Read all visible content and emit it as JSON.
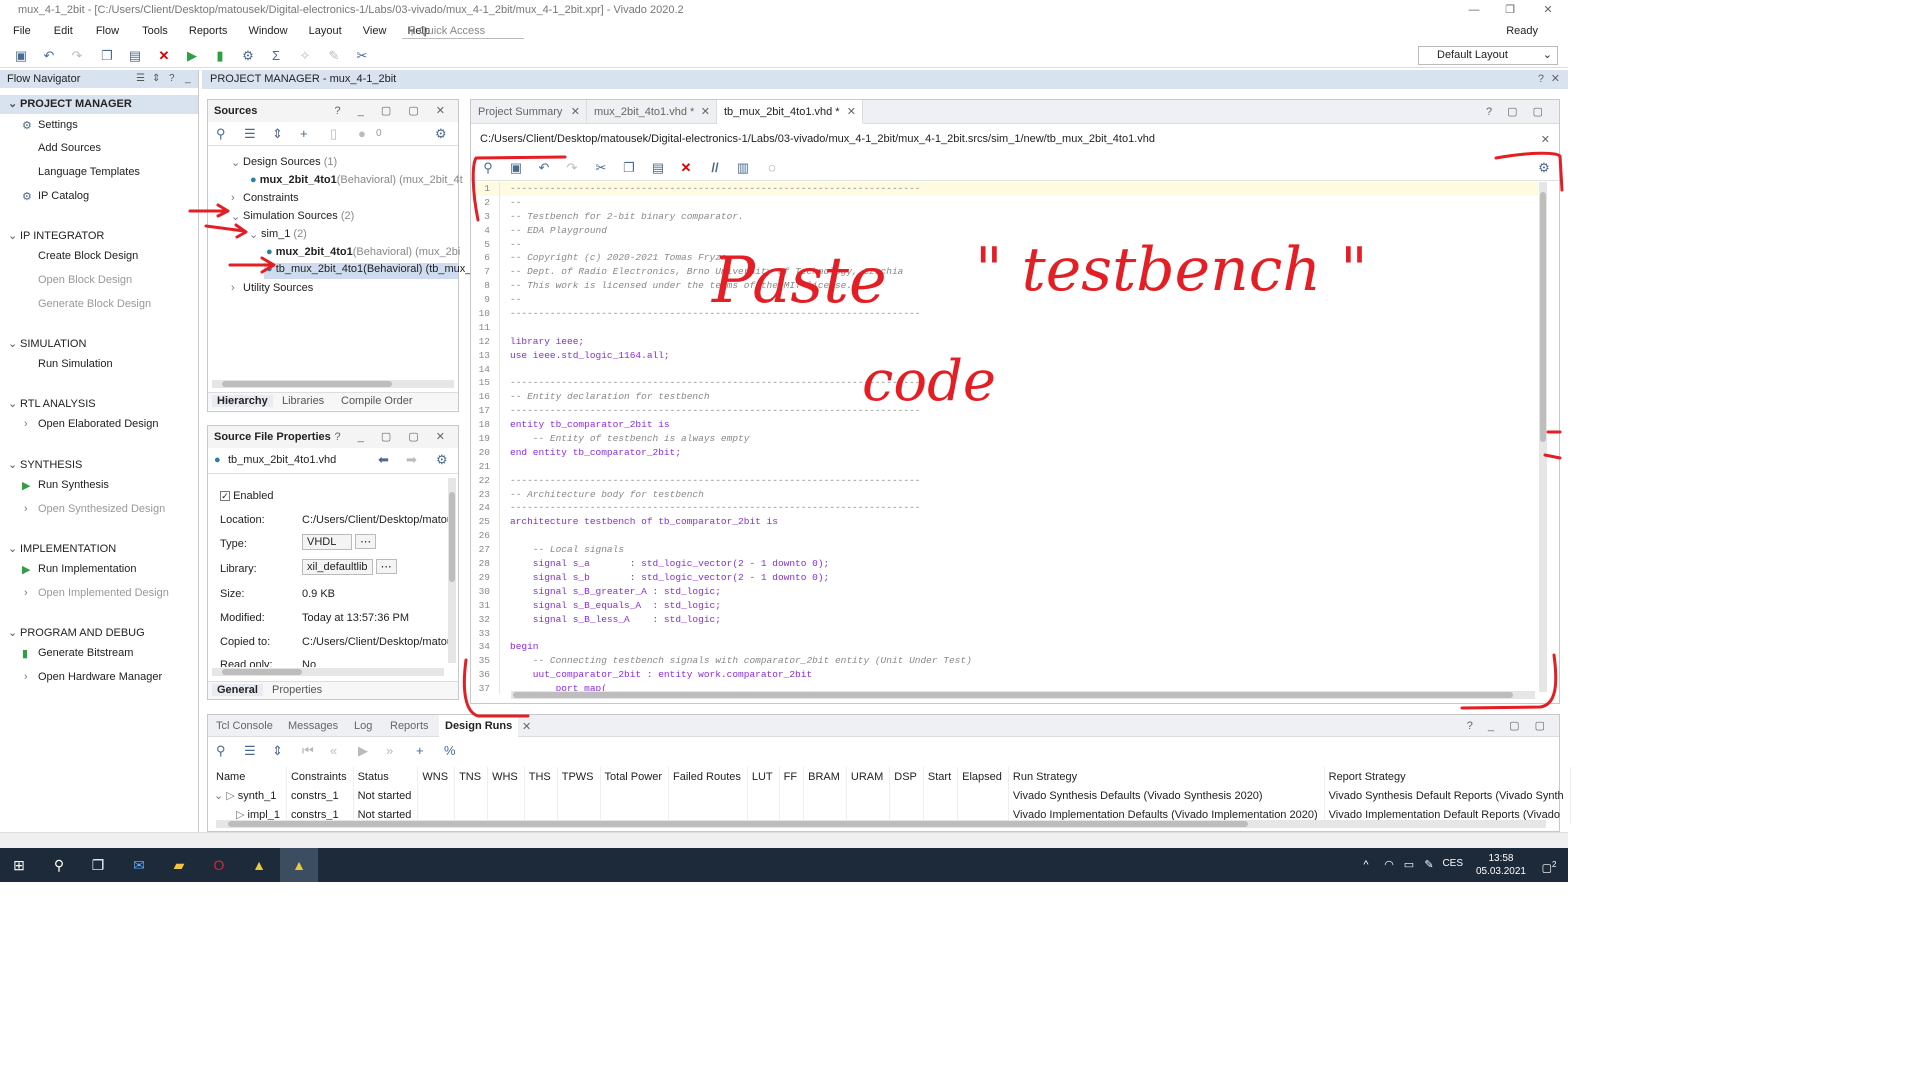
{
  "window": {
    "title": "mux_4-1_2bit - [C:/Users/Client/Desktop/matousek/Digital-electronics-1/Labs/03-vivado/mux_4-1_2bit/mux_4-1_2bit.xpr] - Vivado 2020.2"
  },
  "menu": {
    "items": [
      "File",
      "Edit",
      "Flow",
      "Tools",
      "Reports",
      "Window",
      "Layout",
      "View",
      "Help"
    ],
    "quick_access": "Quick Access",
    "status": "Ready",
    "layout": "Default Layout"
  },
  "flow_nav": {
    "title": "Flow Navigator",
    "sections": [
      {
        "label": "PROJECT MANAGER",
        "items": [
          {
            "label": "Settings"
          },
          {
            "label": "Add Sources"
          },
          {
            "label": "Language Templates"
          },
          {
            "label": "IP Catalog"
          }
        ]
      },
      {
        "label": "IP INTEGRATOR",
        "items": [
          {
            "label": "Create Block Design"
          },
          {
            "label": "Open Block Design"
          },
          {
            "label": "Generate Block Design"
          }
        ]
      },
      {
        "label": "SIMULATION",
        "items": [
          {
            "label": "Run Simulation"
          }
        ]
      },
      {
        "label": "RTL ANALYSIS",
        "items": [
          {
            "label": "Open Elaborated Design"
          }
        ]
      },
      {
        "label": "SYNTHESIS",
        "items": [
          {
            "label": "Run Synthesis"
          },
          {
            "label": "Open Synthesized Design"
          }
        ]
      },
      {
        "label": "IMPLEMENTATION",
        "items": [
          {
            "label": "Run Implementation"
          },
          {
            "label": "Open Implemented Design"
          }
        ]
      },
      {
        "label": "PROGRAM AND DEBUG",
        "items": [
          {
            "label": "Generate Bitstream"
          },
          {
            "label": "Open Hardware Manager"
          }
        ]
      }
    ]
  },
  "pm_bar": {
    "label": "PROJECT MANAGER - mux_4-1_2bit"
  },
  "sources": {
    "title": "Sources",
    "count": "0",
    "tree": [
      {
        "label": "Design Sources",
        "count": "(1)"
      },
      {
        "name": "mux_2bit_4to1",
        "detail": "(Behavioral) (mux_2bit_4t"
      },
      {
        "label": "Constraints"
      },
      {
        "label": "Simulation Sources",
        "count": "(2)"
      },
      {
        "label": "sim_1",
        "count": "(2)"
      },
      {
        "name": "mux_2bit_4to1",
        "detail": "(Behavioral) (mux_2bi"
      },
      {
        "name": "tb_mux_2bit_4to1(Behavioral) (tb_mux_"
      },
      {
        "label": "Utility Sources"
      }
    ],
    "tabs": [
      "Hierarchy",
      "Libraries",
      "Compile Order"
    ]
  },
  "props": {
    "title": "Source File Properties",
    "file": "tb_mux_2bit_4to1.vhd",
    "enabled": "Enabled",
    "rows": [
      {
        "k": "Location:",
        "v": "C:/Users/Client/Desktop/matous"
      },
      {
        "k": "Type:",
        "v": "VHDL"
      },
      {
        "k": "Library:",
        "v": "xil_defaultlib"
      },
      {
        "k": "Size:",
        "v": "0.9 KB"
      },
      {
        "k": "Modified:",
        "v": "Today at 13:57:36 PM"
      },
      {
        "k": "Copied to:",
        "v": "C:/Users/Client/Desktop/matous"
      },
      {
        "k": "Read only:",
        "v": "No"
      }
    ],
    "tabs": [
      "General",
      "Properties"
    ]
  },
  "editor": {
    "tabs": [
      {
        "label": "Project Summary"
      },
      {
        "label": "mux_2bit_4to1.vhd *"
      },
      {
        "label": "tb_mux_2bit_4to1.vhd *"
      }
    ],
    "path": "C:/Users/Client/Desktop/matousek/Digital-electronics-1/Labs/03-vivado/mux_4-1_2bit/mux_4-1_2bit.srcs/sim_1/new/tb_mux_2bit_4to1.vhd",
    "lines": [
      {
        "n": "1",
        "t": "------------------------------------------------------------------------",
        "k": "com"
      },
      {
        "n": "2",
        "t": "--",
        "k": "com"
      },
      {
        "n": "3",
        "t": "-- Testbench for 2-bit binary comparator.",
        "k": "com"
      },
      {
        "n": "4",
        "t": "-- EDA Playground",
        "k": "com"
      },
      {
        "n": "5",
        "t": "--",
        "k": "com"
      },
      {
        "n": "6",
        "t": "-- Copyright (c) 2020-2021 Tomas Fryza",
        "k": "com"
      },
      {
        "n": "7",
        "t": "-- Dept. of Radio Electronics, Brno University of Technology, Czechia",
        "k": "com"
      },
      {
        "n": "8",
        "t": "-- This work is licensed under the terms of the MIT license.",
        "k": "com"
      },
      {
        "n": "9",
        "t": "--",
        "k": "com"
      },
      {
        "n": "10",
        "t": "------------------------------------------------------------------------",
        "k": "com"
      },
      {
        "n": "11",
        "t": "",
        "k": ""
      },
      {
        "n": "12",
        "t": "library ieee;",
        "k": "kw"
      },
      {
        "n": "13",
        "t": "use ieee.std_logic_1164.all;",
        "k": "kw"
      },
      {
        "n": "14",
        "t": "",
        "k": ""
      },
      {
        "n": "15",
        "t": "------------------------------------------------------------------------",
        "k": "com"
      },
      {
        "n": "16",
        "t": "-- Entity declaration for testbench",
        "k": "com"
      },
      {
        "n": "17",
        "t": "------------------------------------------------------------------------",
        "k": "com"
      },
      {
        "n": "18",
        "t": "entity tb_comparator_2bit is",
        "k": "kw"
      },
      {
        "n": "19",
        "t": "    -- Entity of testbench is always empty",
        "k": "com"
      },
      {
        "n": "20",
        "t": "end entity tb_comparator_2bit;",
        "k": "kw"
      },
      {
        "n": "21",
        "t": "",
        "k": ""
      },
      {
        "n": "22",
        "t": "------------------------------------------------------------------------",
        "k": "com"
      },
      {
        "n": "23",
        "t": "-- Architecture body for testbench",
        "k": "com"
      },
      {
        "n": "24",
        "t": "------------------------------------------------------------------------",
        "k": "com"
      },
      {
        "n": "25",
        "t": "architecture testbench of tb_comparator_2bit is",
        "k": "kw"
      },
      {
        "n": "26",
        "t": "",
        "k": ""
      },
      {
        "n": "27",
        "t": "    -- Local signals",
        "k": "com"
      },
      {
        "n": "28",
        "t": "    signal s_a       : std_logic_vector(2 - 1 downto 0);",
        "k": "kw"
      },
      {
        "n": "29",
        "t": "    signal s_b       : std_logic_vector(2 - 1 downto 0);",
        "k": "kw"
      },
      {
        "n": "30",
        "t": "    signal s_B_greater_A : std_logic;",
        "k": "kw"
      },
      {
        "n": "31",
        "t": "    signal s_B_equals_A  : std_logic;",
        "k": "kw"
      },
      {
        "n": "32",
        "t": "    signal s_B_less_A    : std_logic;",
        "k": "kw"
      },
      {
        "n": "33",
        "t": "",
        "k": ""
      },
      {
        "n": "34",
        "t": "begin",
        "k": "kw"
      },
      {
        "n": "35",
        "t": "    -- Connecting testbench signals with comparator_2bit entity (Unit Under Test)",
        "k": "com"
      },
      {
        "n": "36",
        "t": "    uut_comparator_2bit : entity work.comparator_2bit",
        "k": "kw"
      },
      {
        "n": "37",
        "t": "        port map(",
        "k": "kw"
      }
    ]
  },
  "bottom": {
    "tabs": [
      {
        "label": "Tcl Console"
      },
      {
        "label": "Messages"
      },
      {
        "label": "Log"
      },
      {
        "label": "Reports"
      },
      {
        "label": "Design Runs"
      }
    ],
    "columns": [
      "Name",
      "Constraints",
      "Status",
      "WNS",
      "TNS",
      "WHS",
      "THS",
      "TPWS",
      "Total Power",
      "Failed Routes",
      "LUT",
      "FF",
      "BRAM",
      "URAM",
      "DSP",
      "Start",
      "Elapsed",
      "Run Strategy",
      "Report Strategy"
    ],
    "rows": [
      {
        "name": "synth_1",
        "constraints": "constrs_1",
        "status": "Not started",
        "run_strategy": "Vivado Synthesis Defaults (Vivado Synthesis 2020)",
        "report_strategy": "Vivado Synthesis Default Reports (Vivado Synth"
      },
      {
        "name": "impl_1",
        "constraints": "constrs_1",
        "status": "Not started",
        "run_strategy": "Vivado Implementation Defaults (Vivado Implementation 2020)",
        "report_strategy": "Vivado Implementation Default Reports (Vivado"
      }
    ]
  },
  "annotation": {
    "text1": "Paste",
    "text2": "\" testbench \"",
    "text3": "code"
  },
  "taskbar": {
    "lang": "CES",
    "time": "13:58",
    "date": "05.03.2021",
    "badge": "2"
  }
}
